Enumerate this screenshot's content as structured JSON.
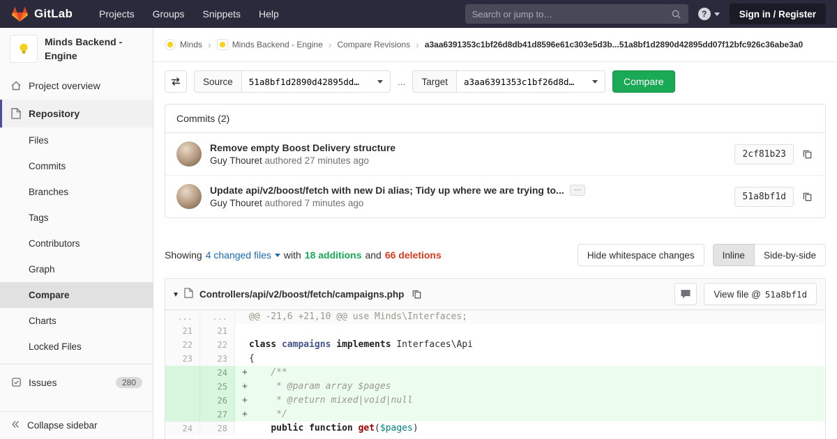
{
  "colors": {
    "navbar_bg": "#2a2a3c",
    "accent_indigo": "#4b4ba3",
    "success_green": "#1aaa55",
    "danger_red": "#db3b21",
    "link_blue": "#1b69b6",
    "brand_orange": "#fc6d26"
  },
  "navbar": {
    "brand": "GitLab",
    "menu": [
      "Projects",
      "Groups",
      "Snippets",
      "Help"
    ],
    "search_placeholder": "Search or jump to…",
    "sign_in": "Sign in / Register"
  },
  "sidebar": {
    "project_name": "Minds Backend - Engine",
    "items": [
      {
        "label": "Project overview"
      },
      {
        "label": "Repository"
      }
    ],
    "repo_subitems": [
      {
        "label": "Files"
      },
      {
        "label": "Commits"
      },
      {
        "label": "Branches"
      },
      {
        "label": "Tags"
      },
      {
        "label": "Contributors"
      },
      {
        "label": "Graph"
      },
      {
        "label": "Compare",
        "active": true
      },
      {
        "label": "Charts"
      },
      {
        "label": "Locked Files"
      }
    ],
    "issues_label": "Issues",
    "issues_count": "280",
    "collapse_label": "Collapse sidebar"
  },
  "breadcrumb": {
    "items": [
      "Minds",
      "Minds Backend - Engine",
      "Compare Revisions"
    ],
    "current": "a3aa6391353c1bf26d8db41d8596e61c303e5d3b...51a8bf1d2890d42895dd07f12bfc926c36abe3a0"
  },
  "compare_form": {
    "source_label": "Source",
    "source_value": "51a8bf1d2890d42895dd…",
    "separator": "...",
    "target_label": "Target",
    "target_value": "a3aa6391353c1bf26d8d…",
    "compare_button": "Compare"
  },
  "commits": {
    "header": "Commits (2)",
    "items": [
      {
        "title": "Remove empty Boost Delivery structure",
        "author": "Guy Thouret",
        "meta": "authored 27 minutes ago",
        "sha": "2cf81b23",
        "expandable": false
      },
      {
        "title": "Update api/v2/boost/fetch with new Di alias; Tidy up where we are trying to...",
        "author": "Guy Thouret",
        "meta": "authored 7 minutes ago",
        "sha": "51a8bf1d",
        "expandable": true
      }
    ]
  },
  "summary": {
    "showing": "Showing",
    "changed_files": "4 changed files",
    "with_text": "with",
    "additions": "18 additions",
    "and_text": "and",
    "deletions": "66 deletions",
    "hide_whitespace": "Hide whitespace changes",
    "inline": "Inline",
    "side_by_side": "Side-by-side"
  },
  "diff": {
    "file_path": "Controllers/api/v2/boost/fetch/campaigns.php",
    "view_file_label": "View file @",
    "view_file_sha": "51a8bf1d",
    "lines": [
      {
        "old": "...",
        "new": "...",
        "type": "hunk",
        "sign": " ",
        "segments": [
          {
            "t": "@@ -21,6 +21,10 @@ use Minds\\Interfaces;",
            "c": "hunk"
          }
        ]
      },
      {
        "old": "21",
        "new": "21",
        "type": "context",
        "sign": " ",
        "segments": []
      },
      {
        "old": "22",
        "new": "22",
        "type": "context",
        "sign": " ",
        "segments": [
          {
            "t": "class ",
            "c": "k"
          },
          {
            "t": "campaigns",
            "c": "nc"
          },
          {
            "t": " ",
            "c": ""
          },
          {
            "t": "implements",
            "c": "k"
          },
          {
            "t": " Interfaces\\Api",
            "c": ""
          }
        ]
      },
      {
        "old": "23",
        "new": "23",
        "type": "context",
        "sign": " ",
        "segments": [
          {
            "t": "{",
            "c": ""
          }
        ]
      },
      {
        "old": "",
        "new": "24",
        "type": "add",
        "sign": "+",
        "segments": [
          {
            "t": "    /**",
            "c": "c"
          }
        ]
      },
      {
        "old": "",
        "new": "25",
        "type": "add",
        "sign": "+",
        "segments": [
          {
            "t": "     * @param array $pages",
            "c": "c"
          }
        ]
      },
      {
        "old": "",
        "new": "26",
        "type": "add",
        "sign": "+",
        "segments": [
          {
            "t": "     * @return mixed|void|null",
            "c": "c"
          }
        ]
      },
      {
        "old": "",
        "new": "27",
        "type": "add",
        "sign": "+",
        "segments": [
          {
            "t": "     */",
            "c": "c"
          }
        ]
      },
      {
        "old": "24",
        "new": "28",
        "type": "context",
        "sign": " ",
        "segments": [
          {
            "t": "    ",
            "c": ""
          },
          {
            "t": "public",
            "c": "k"
          },
          {
            "t": " ",
            "c": ""
          },
          {
            "t": "function",
            "c": "k"
          },
          {
            "t": " ",
            "c": ""
          },
          {
            "t": "get",
            "c": "nf"
          },
          {
            "t": "(",
            "c": ""
          },
          {
            "t": "$pages",
            "c": "nv"
          },
          {
            "t": ")",
            "c": ""
          }
        ]
      }
    ]
  }
}
